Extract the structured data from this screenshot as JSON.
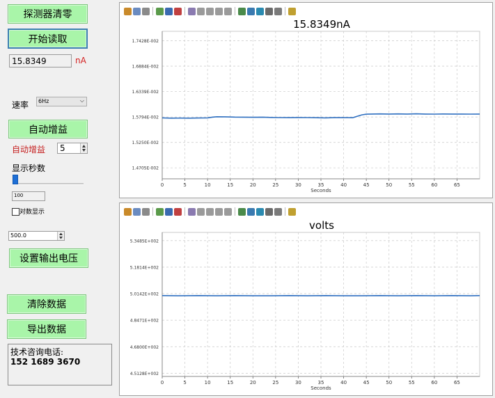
{
  "sidebar": {
    "zero_button": "探测器清零",
    "start_button": "开始读取",
    "reading_value": "15.8349",
    "reading_unit": "nA",
    "rate_label": "速率",
    "rate_value": "6Hz",
    "auto_gain_button": "自动增益",
    "auto_gain_label": "自动增益",
    "auto_gain_value": "5",
    "display_seconds_label": "显示秒数",
    "seconds_value": "100",
    "log_display_label": "对数显示",
    "voltage_value": "500.0",
    "set_voltage_button": "设置输出电压",
    "clear_button": "清除数据",
    "export_button": "导出数据",
    "contact_label": "技术咨询电话:",
    "contact_phone": "152 1689 3670"
  },
  "chart_data": [
    {
      "type": "line",
      "title": "15.8349nA",
      "xlabel": "Seconds",
      "ylabel": "",
      "xlim": [
        0,
        70
      ],
      "ylim": [
        1.447,
        1.763
      ],
      "xticks": [
        "0",
        "5",
        "10",
        "15",
        "20",
        "25",
        "30",
        "35",
        "40",
        "45",
        "50",
        "55",
        "60",
        "65"
      ],
      "yticks": [
        "1.7428E-002",
        "1.6884E-002",
        "1.6339E-002",
        "1.5794E-002",
        "1.5250E-002",
        "1.4705E-002"
      ],
      "ytick_values": [
        1.7428,
        1.6884,
        1.6339,
        1.5794,
        1.525,
        1.4705
      ],
      "series": [
        {
          "x": [
            0,
            2,
            4,
            6,
            8,
            10,
            11,
            12,
            14,
            16,
            18,
            20,
            22,
            24,
            26,
            28,
            30,
            32,
            34,
            36,
            38,
            40,
            42,
            43,
            44,
            45,
            46,
            48,
            50,
            52,
            54,
            56,
            58,
            60,
            62,
            64,
            66,
            68,
            70
          ],
          "y": [
            1.5775,
            1.577,
            1.5772,
            1.577,
            1.5773,
            1.5775,
            1.579,
            1.58,
            1.5798,
            1.5792,
            1.579,
            1.5788,
            1.579,
            1.5785,
            1.5782,
            1.578,
            1.5783,
            1.5781,
            1.5779,
            1.5776,
            1.578,
            1.5782,
            1.5778,
            1.581,
            1.584,
            1.5855,
            1.5858,
            1.586,
            1.5857,
            1.586,
            1.5858,
            1.5862,
            1.5857,
            1.5856,
            1.5859,
            1.5857,
            1.5858,
            1.5856,
            1.5857
          ]
        }
      ]
    },
    {
      "type": "line",
      "title": "volts",
      "xlabel": "Seconds",
      "ylabel": "",
      "xlim": [
        0,
        70
      ],
      "ylim": [
        4.4928,
        5.4002
      ],
      "xticks": [
        "0",
        "5",
        "10",
        "15",
        "20",
        "25",
        "30",
        "35",
        "40",
        "45",
        "50",
        "55",
        "60",
        "65"
      ],
      "yticks": [
        "5.3485E+002",
        "5.1814E+002",
        "5.0142E+002",
        "4.8471E+002",
        "4.6800E+002",
        "4.5128E+002"
      ],
      "ytick_values": [
        5.3485,
        5.1814,
        5.0142,
        4.8471,
        4.68,
        4.5128
      ],
      "series": [
        {
          "x": [
            0,
            4,
            8,
            12,
            16,
            20,
            24,
            28,
            32,
            36,
            40,
            44,
            48,
            52,
            56,
            60,
            64,
            68,
            70
          ],
          "y": [
            5.002,
            5.001,
            5.002,
            5.001,
            5.002,
            5.001,
            5.001,
            5.002,
            5.001,
            5.002,
            5.001,
            5.001,
            5.002,
            5.001,
            5.002,
            5.001,
            5.002,
            5.001,
            5.002
          ]
        }
      ]
    }
  ]
}
